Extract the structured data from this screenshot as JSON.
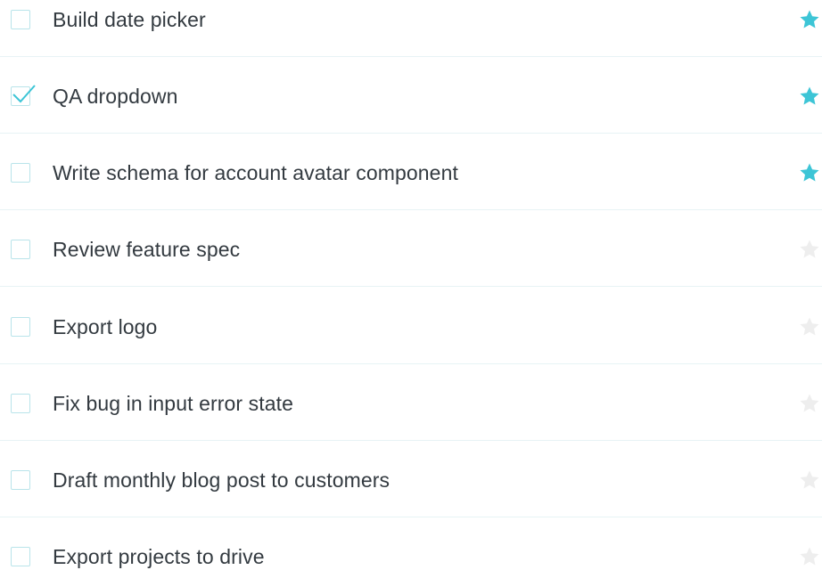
{
  "colors": {
    "accent": "#3dc5d6",
    "star_off": "#eeeeee",
    "checkbox_border": "#b9e4ea",
    "divider": "#e7f3f5",
    "text": "#333a40"
  },
  "tasks": [
    {
      "label": "Build date picker",
      "checked": false,
      "starred": true
    },
    {
      "label": "QA dropdown",
      "checked": true,
      "starred": true
    },
    {
      "label": "Write schema for account avatar component",
      "checked": false,
      "starred": true
    },
    {
      "label": "Review feature spec",
      "checked": false,
      "starred": false
    },
    {
      "label": "Export logo",
      "checked": false,
      "starred": false
    },
    {
      "label": "Fix bug in input error state",
      "checked": false,
      "starred": false
    },
    {
      "label": "Draft monthly blog post to customers",
      "checked": false,
      "starred": false
    },
    {
      "label": "Export projects to drive",
      "checked": false,
      "starred": false
    }
  ]
}
